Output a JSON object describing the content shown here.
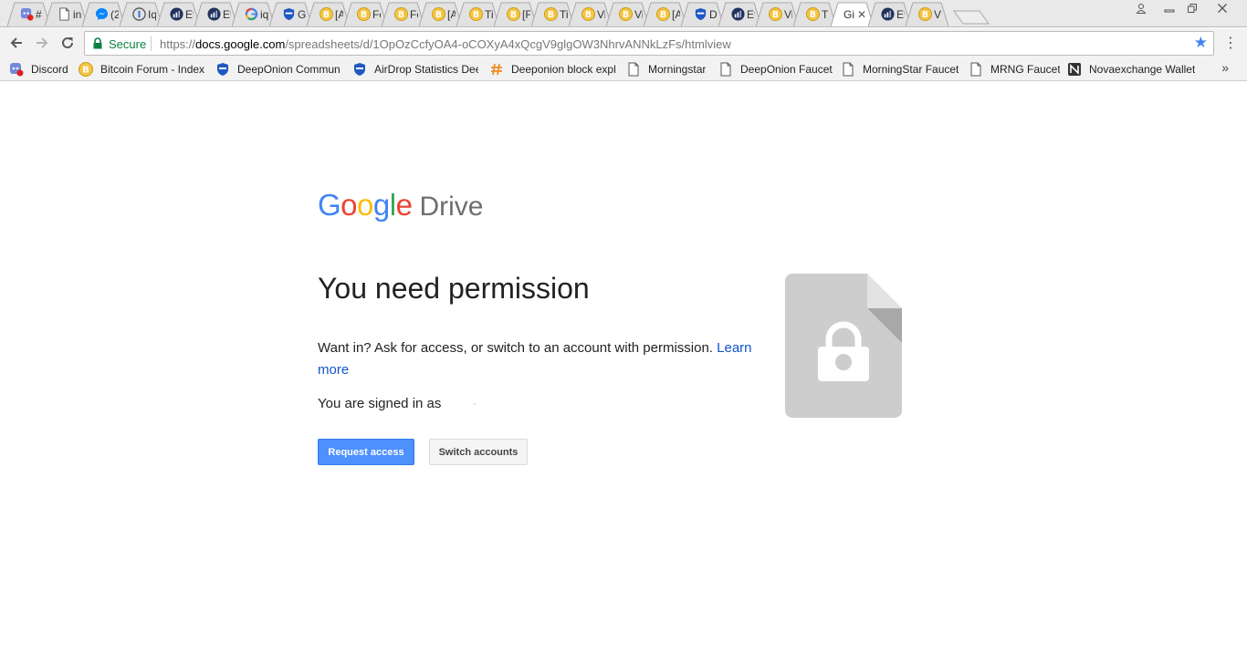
{
  "colors": {
    "google_blue": "#4285F4",
    "google_red": "#EA4335",
    "google_yellow": "#FBBC05",
    "google_green": "#34A853",
    "link": "#1155cc",
    "secure_green": "#0b8043",
    "primary_button": "#4d90fe"
  },
  "tabs": [
    {
      "title": "#",
      "icon": "discord-icon"
    },
    {
      "title": "in",
      "icon": "page-icon"
    },
    {
      "title": "(2",
      "icon": "messenger-icon"
    },
    {
      "title": "Iq",
      "icon": "iq-icon"
    },
    {
      "title": "Et",
      "icon": "etherscan-icon"
    },
    {
      "title": "Et",
      "icon": "etherscan-icon"
    },
    {
      "title": "iq",
      "icon": "google-icon"
    },
    {
      "title": "G",
      "icon": "shield-icon"
    },
    {
      "title": "[A",
      "icon": "bitcoin-icon"
    },
    {
      "title": "Fe",
      "icon": "bitcoin-icon"
    },
    {
      "title": "Fe",
      "icon": "bitcoin-icon"
    },
    {
      "title": "[A",
      "icon": "bitcoin-icon"
    },
    {
      "title": "Ti",
      "icon": "bitcoin-icon"
    },
    {
      "title": "[F",
      "icon": "bitcoin-icon"
    },
    {
      "title": "Ti",
      "icon": "bitcoin-icon"
    },
    {
      "title": "Vi",
      "icon": "bitcoin-icon"
    },
    {
      "title": "Vi",
      "icon": "bitcoin-icon"
    },
    {
      "title": "[A",
      "icon": "bitcoin-icon"
    },
    {
      "title": "D",
      "icon": "shield-icon"
    },
    {
      "title": "Et",
      "icon": "etherscan-icon"
    },
    {
      "title": "Vi",
      "icon": "bitcoin-icon"
    },
    {
      "title": "T",
      "icon": "bitcoin-icon"
    },
    {
      "title": "Gi",
      "icon": "none",
      "active": true
    },
    {
      "title": "Et",
      "icon": "etherscan-icon"
    },
    {
      "title": "V",
      "icon": "bitcoin-icon"
    }
  ],
  "toolbar": {
    "secure_label": "Secure",
    "url_scheme": "https://",
    "url_host": "docs.google.com",
    "url_path": "/spreadsheets/d/1OpOzCcfyOA4-oCOXyA4xQcgV9glgOW3NhrvANNkLzFs/htmlview"
  },
  "bookmarks": [
    {
      "label": "Discord",
      "icon": "discord-icon"
    },
    {
      "label": "Bitcoin Forum - Index",
      "icon": "bitcoin-icon"
    },
    {
      "label": "DeepOnion Commun",
      "icon": "shield-icon"
    },
    {
      "label": "AirDrop Statistics Dee",
      "icon": "shield-icon"
    },
    {
      "label": "Deeponion block expl",
      "icon": "hash-icon"
    },
    {
      "label": "Morningstar",
      "icon": "page-icon"
    },
    {
      "label": "DeepOnion Faucet",
      "icon": "page-icon"
    },
    {
      "label": "MorningStar Faucet",
      "icon": "page-icon"
    },
    {
      "label": "MRNG Faucet",
      "icon": "page-icon"
    },
    {
      "label": "Novaexchange Wallet",
      "icon": "novaexchange-icon"
    }
  ],
  "page": {
    "logo_letters": [
      "G",
      "o",
      "o",
      "g",
      "l",
      "e"
    ],
    "logo_product": "Drive",
    "heading": "You need permission",
    "description": "Want in? Ask for access, or switch to an account with permission.",
    "learn_more": "Learn more",
    "signed_in_label": "You are signed in as",
    "signed_in_email": "-",
    "request_access_label": "Request access",
    "switch_accounts_label": "Switch accounts"
  }
}
